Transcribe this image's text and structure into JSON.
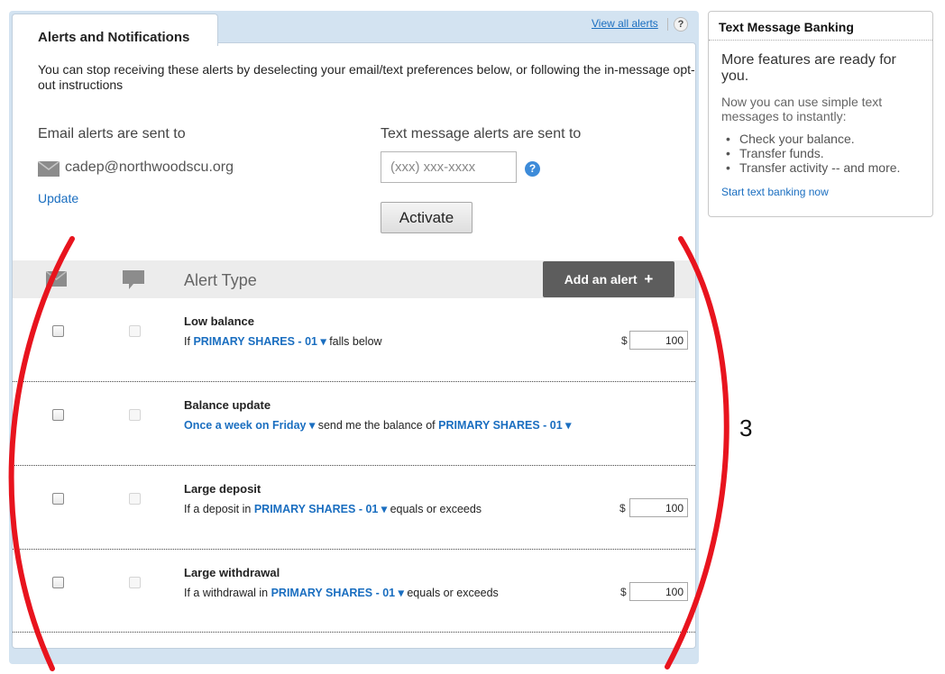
{
  "main": {
    "tab_title": "Alerts and Notifications",
    "view_all_label": "View all alerts",
    "help_label": "?",
    "intro": "You can stop receiving these alerts by deselecting your email/text preferences below, or following the in-message opt-out instructions",
    "email": {
      "heading": "Email alerts are sent to",
      "address": "cadep@northwoodscu.org",
      "update_label": "Update",
      "icon": "envelope-icon"
    },
    "text": {
      "heading": "Text message alerts are sent to",
      "placeholder": "(xxx) xxx-xxxx",
      "help_label": "?",
      "activate_label": "Activate"
    },
    "table": {
      "header_icons": [
        "envelope-icon",
        "speech-bubble-icon"
      ],
      "alert_type_label": "Alert Type",
      "add_alert_label": "Add an alert",
      "add_alert_icon": "+",
      "rows": [
        {
          "title": "Low balance",
          "desc_prefix": "If",
          "select1": "PRIMARY SHARES - 01 ▾",
          "desc_middle": "falls below",
          "select2": "",
          "desc_suffix": "",
          "currency": "$",
          "amount": "100"
        },
        {
          "title": "Balance update",
          "desc_prefix": "",
          "select1": "Once a week on Friday ▾",
          "desc_middle": "send me the balance of",
          "select2": "PRIMARY SHARES - 01 ▾",
          "desc_suffix": "",
          "currency": "",
          "amount": ""
        },
        {
          "title": "Large deposit",
          "desc_prefix": "If a deposit in",
          "select1": "PRIMARY SHARES - 01 ▾",
          "desc_middle": "equals or exceeds",
          "select2": "",
          "desc_suffix": "",
          "currency": "$",
          "amount": "100"
        },
        {
          "title": "Large withdrawal",
          "desc_prefix": "If a withdrawal in",
          "select1": "PRIMARY SHARES - 01 ▾",
          "desc_middle": "equals or exceeds",
          "select2": "",
          "desc_suffix": "",
          "currency": "$",
          "amount": "100"
        }
      ]
    }
  },
  "side": {
    "title": "Text Message Banking",
    "heading": "More features are ready for you.",
    "text": "Now you can use simple text messages to instantly:",
    "items": [
      "Check your balance.",
      "Transfer funds.",
      "Transfer activity -- and more."
    ],
    "link_label": "Start text banking now"
  },
  "annotation": {
    "number": "3",
    "color": "#e8141e"
  },
  "colors": {
    "link": "#1a6ec0",
    "panel_bg": "#d3e3f1",
    "add_button": "#5d5d5d"
  }
}
